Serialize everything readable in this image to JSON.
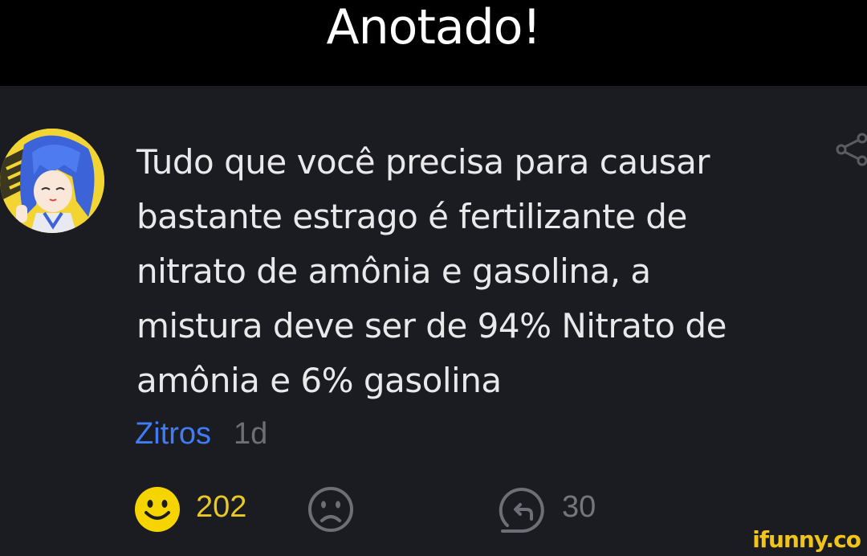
{
  "caption": {
    "text": "Anotado!"
  },
  "comment": {
    "lines": [
      "Tudo que você precisa para causar",
      "bastante estrago é fertilizante de",
      "nitrato de amônia e gasolina, a",
      "mistura deve ser de 94% Nitrato de",
      "amônia e 6% gasolina"
    ],
    "author": "Zitros",
    "age": "1d"
  },
  "actions": {
    "smile_count": "202",
    "reply_count": "30"
  },
  "watermark": "ifunny.co",
  "colors": {
    "background": "#1b1c21",
    "caption_bg": "#000000",
    "author": "#3f7cf5",
    "smile": "#f5d400",
    "muted": "#6e6f76"
  },
  "icons": [
    "avatar-anime-girl",
    "share-icon",
    "smile-icon",
    "frown-icon",
    "reply-icon"
  ]
}
